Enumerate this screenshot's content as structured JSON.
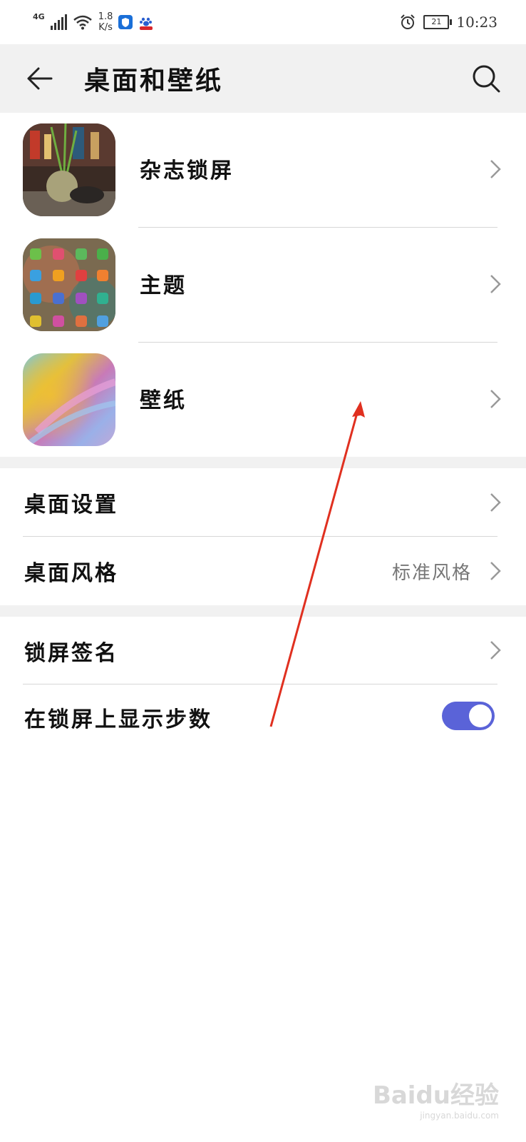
{
  "status_bar": {
    "network": "4G",
    "speed_value": "1.8",
    "speed_unit": "K/s",
    "battery": "21",
    "time": "10:23"
  },
  "header": {
    "title": "桌面和壁纸"
  },
  "section1": {
    "items": [
      {
        "label": "杂志锁屏"
      },
      {
        "label": "主题"
      },
      {
        "label": "壁纸"
      }
    ]
  },
  "section2": {
    "items": [
      {
        "label": "桌面设置"
      },
      {
        "label": "桌面风格",
        "value": "标准风格"
      }
    ]
  },
  "section3": {
    "items": [
      {
        "label": "锁屏签名"
      },
      {
        "label": "在锁屏上显示步数",
        "toggle_on": true
      }
    ]
  },
  "colors": {
    "toggle_on": "#5a63d8",
    "annotation_arrow": "#e03020"
  },
  "watermark": {
    "main": "Baidu经验",
    "sub": "jingyan.baidu.com"
  }
}
